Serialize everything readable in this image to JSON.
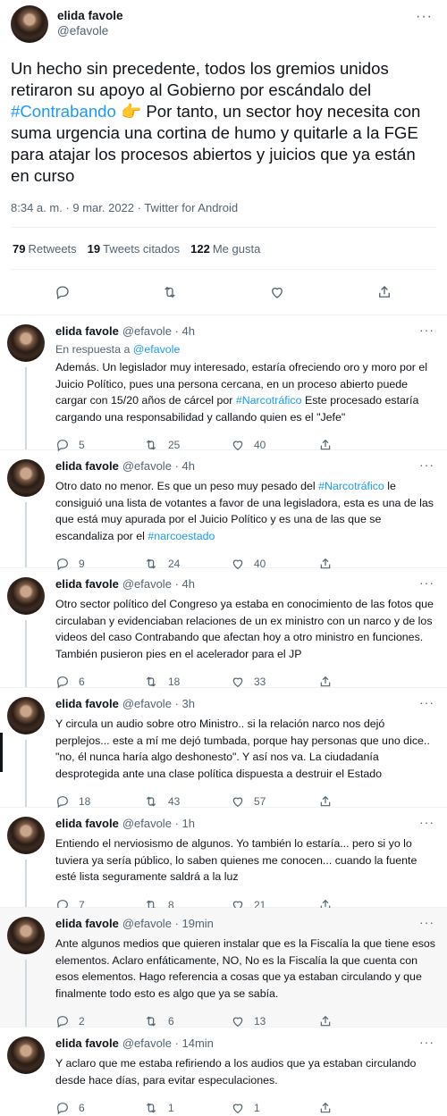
{
  "main_tweet": {
    "name": "elida favole",
    "handle": "@efavole",
    "text_parts": [
      "Un hecho sin precedente, todos los gremios unidos retiraron su apoyo al Gobierno por escándalo del ",
      "#Contrabando",
      " 👉 Por tanto, un sector hoy necesita con suma urgencia una cortina de humo y quitarle a la FGE para atajar los procesos abiertos y juicios que ya están en curso"
    ],
    "meta": "8:34 a. m. · 9 mar. 2022 · Twitter for Android",
    "stats": {
      "retweets_count": "79",
      "retweets_label": "Retweets",
      "quotes_count": "19",
      "quotes_label": "Tweets citados",
      "likes_count": "122",
      "likes_label": "Me gusta"
    }
  },
  "replies": [
    {
      "name": "elida favole",
      "handle": "@efavole",
      "time": "· 4h",
      "reply_to_prefix": "En respuesta a ",
      "reply_to_handle": "@efavole",
      "text_parts": [
        "Además. Un legislador muy interesado, estaría ofreciendo oro y moro por el Juicio Político, pues una persona cercana, en un proceso abierto puede cargar con 15/20 años de cárcel por ",
        "#Narcotráfico",
        " Este procesado estaría cargando una responsabilidad y callando quien es el \"Jefe\""
      ],
      "replies": "5",
      "retweets": "25",
      "likes": "40"
    },
    {
      "name": "elida favole",
      "handle": "@efavole",
      "time": "· 4h",
      "text_parts": [
        "Otro dato no menor. Es que un peso muy pesado del ",
        "#Narcotráfico",
        " le consiguió una lista de votantes a favor de una legisladora, esta es una de las que está muy apurada por el Juicio Político y es una de las que se escandaliza por el ",
        "#narcoestado",
        ""
      ],
      "replies": "9",
      "retweets": "24",
      "likes": "40"
    },
    {
      "name": "elida favole",
      "handle": "@efavole",
      "time": "· 4h",
      "text_parts": [
        "Otro sector político del Congreso ya estaba en conocimiento de las fotos que circulaban y evidenciaban relaciones de un ex ministro con un narco y de los videos del caso Contrabando que afectan hoy a otro ministro en funciones. También pusieron pies en el acelerador para el JP"
      ],
      "replies": "6",
      "retweets": "18",
      "likes": "33"
    },
    {
      "name": "elida favole",
      "handle": "@efavole",
      "time": "· 3h",
      "text_parts": [
        "Y circula un audio sobre otro Ministro.. si la relación narco nos dejó perplejos... este a mí me dejó tumbada, porque hay personas que uno dice.. \"no, él nunca haría algo deshonesto\". Y así nos va. La ciudadanía desprotegida ante una clase política dispuesta a destruir el Estado"
      ],
      "replies": "18",
      "retweets": "43",
      "likes": "57"
    },
    {
      "name": "elida favole",
      "handle": "@efavole",
      "time": "· 1h",
      "text_parts": [
        "Entiendo el nerviosismo de algunos. Yo también lo estaría... pero si yo lo tuviera ya sería público, lo saben quienes me conocen... cuando la fuente esté lista seguramente saldrá a la luz"
      ],
      "replies": "7",
      "retweets": "8",
      "likes": "21"
    },
    {
      "name": "elida favole",
      "handle": "@efavole",
      "time": "· 19min",
      "text_parts": [
        "Ante algunos medios que quieren instalar que es la Fiscalía la que tiene esos elementos. Aclaro enfáticamente, NO, No es la Fiscalía la que cuenta con esos elementos. Hago referencia a cosas que ya estaban circulando y que finalmente todo esto es algo que ya se sabía."
      ],
      "replies": "2",
      "retweets": "6",
      "likes": "13"
    },
    {
      "name": "elida favole",
      "handle": "@efavole",
      "time": "· 14min",
      "text_parts": [
        "Y aclaro que me estaba refiriendo a los audios que ya estaban circulando desde hace días, para evitar especulaciones."
      ],
      "replies": "6",
      "retweets": "1",
      "likes": "1"
    }
  ],
  "colors": {
    "accent": "#1d9bf0",
    "text": "#0f1419",
    "muted": "#536471",
    "divider": "#eff3f4"
  },
  "icons": [
    "more-icon",
    "reply-icon",
    "retweet-icon",
    "like-icon",
    "share-icon"
  ]
}
